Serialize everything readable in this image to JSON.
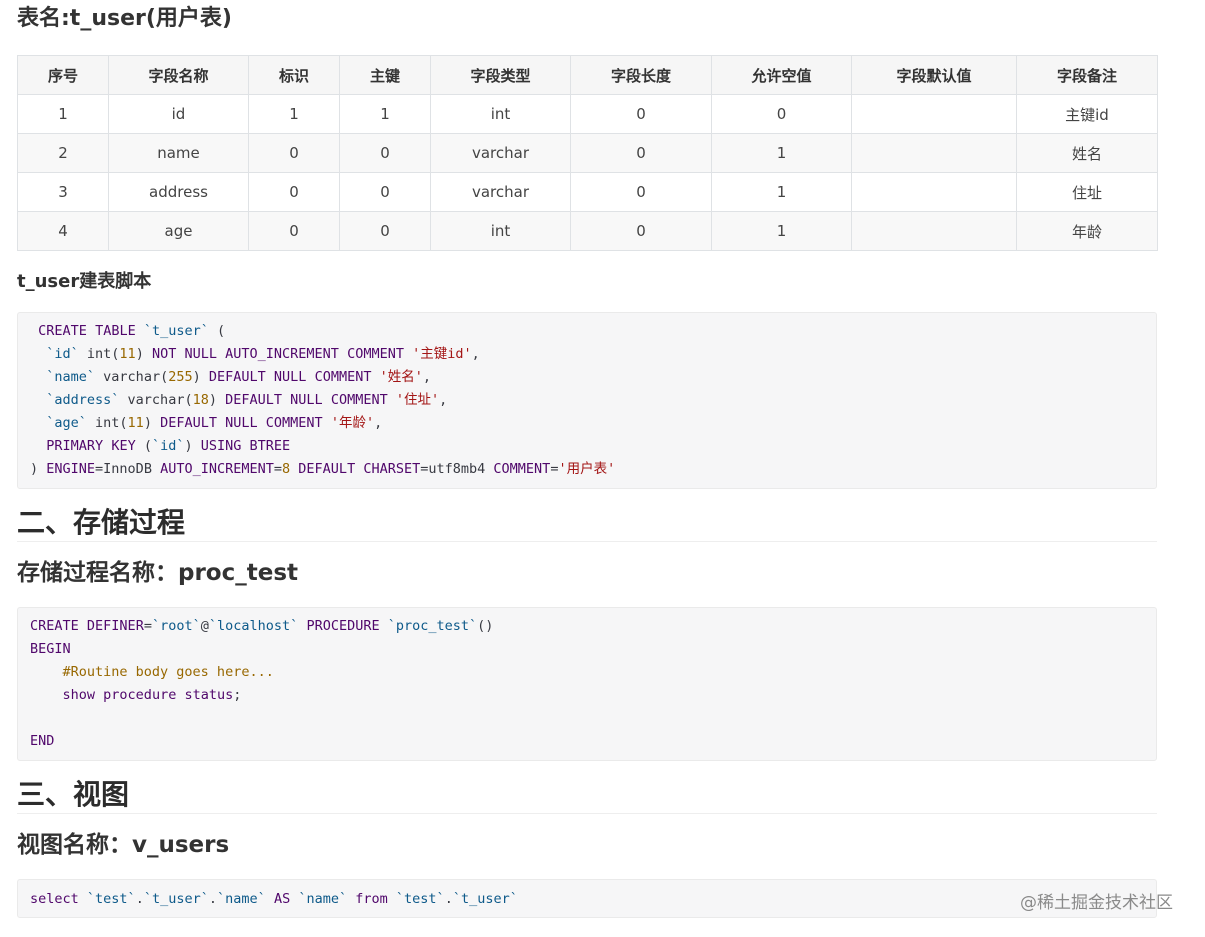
{
  "table_section": {
    "title": "表名:t_user(用户表)",
    "headers": [
      "序号",
      "字段名称",
      "标识",
      "主键",
      "字段类型",
      "字段长度",
      "允许空值",
      "字段默认值",
      "字段备注"
    ],
    "rows": [
      [
        "1",
        "id",
        "1",
        "1",
        "int",
        "0",
        "0",
        "",
        "主键id"
      ],
      [
        "2",
        "name",
        "0",
        "0",
        "varchar",
        "0",
        "1",
        "",
        "姓名"
      ],
      [
        "3",
        "address",
        "0",
        "0",
        "varchar",
        "0",
        "1",
        "",
        "住址"
      ],
      [
        "4",
        "age",
        "0",
        "0",
        "int",
        "0",
        "1",
        "",
        "年龄"
      ]
    ]
  },
  "script_section": {
    "title": "t_user建表脚本",
    "lines": [
      " CREATE TABLE `t_user` (",
      "  `id` int(11) NOT NULL AUTO_INCREMENT COMMENT '主键id',",
      "  `name` varchar(255) DEFAULT NULL COMMENT '姓名',",
      "  `address` varchar(18) DEFAULT NULL COMMENT '住址',",
      "  `age` int(11) DEFAULT NULL COMMENT '年龄',",
      "  PRIMARY KEY (`id`) USING BTREE",
      ") ENGINE=InnoDB AUTO_INCREMENT=8 DEFAULT CHARSET=utf8mb4 COMMENT='用户表'"
    ]
  },
  "procedure_section": {
    "heading": "二、存储过程",
    "subheading": "存储过程名称：proc_test",
    "lines": [
      "CREATE DEFINER=`root`@`localhost` PROCEDURE `proc_test`()",
      "BEGIN",
      "    #Routine body goes here...",
      "    show procedure status;",
      "",
      "END"
    ]
  },
  "view_section": {
    "heading": "三、视图",
    "subheading": "视图名称：v_users",
    "lines": [
      "select `test`.`t_user`.`name` AS `name` from `test`.`t_user`"
    ]
  },
  "watermark": "@稀土掘金技术社区"
}
